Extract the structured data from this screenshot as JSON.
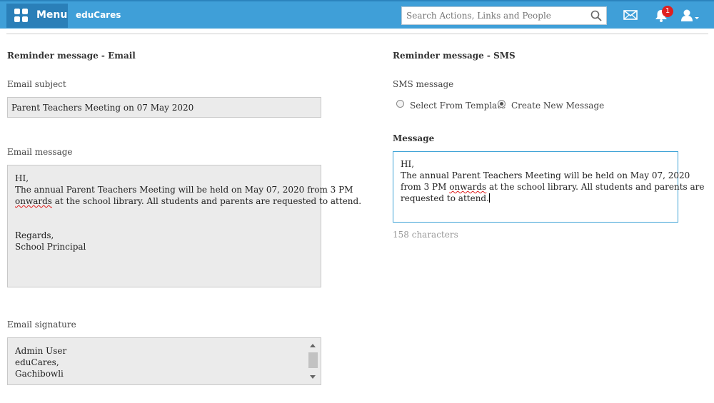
{
  "header": {
    "menu_label": "Menu",
    "brand": "eduCares",
    "search_placeholder": "Search Actions, Links and People",
    "notification_count": "1",
    "bar_color": "#3f9fd8",
    "menu_color": "#2a7fb8"
  },
  "email": {
    "section_title": "Reminder message - Email",
    "subject_label": "Email subject",
    "subject_value": "Parent Teachers Meeting on 07 May 2020",
    "message_label": "Email message",
    "message_lines": {
      "l1": "HI,",
      "l2": "The annual Parent Teachers Meeting will be held on May 07, 2020 from 3 PM",
      "l3_word": "onwards",
      "l3_rest": " at the school library. All students and parents are requested to attend.",
      "l4": "Regards,",
      "l5": "School Principal"
    },
    "signature_label": "Email signature",
    "signature_lines": {
      "l1": "Admin User",
      "l2": "eduCares,",
      "l3": "Gachibowli"
    }
  },
  "sms": {
    "section_title": "Reminder message - SMS",
    "message_type_label": "SMS message",
    "option_template": "Select From Template",
    "option_new": "Create New Message",
    "selected_option": "Create New Message",
    "message_heading": "Message",
    "message_lines": {
      "l1": "HI,",
      "l2": "The annual Parent Teachers Meeting will be held on May 07, 2020",
      "l3_start": "from 3 PM ",
      "l3_word": "onwards",
      "l3_rest": " at the school library. All students and parents are",
      "l4": "requested to attend."
    },
    "char_count": "158  characters"
  }
}
